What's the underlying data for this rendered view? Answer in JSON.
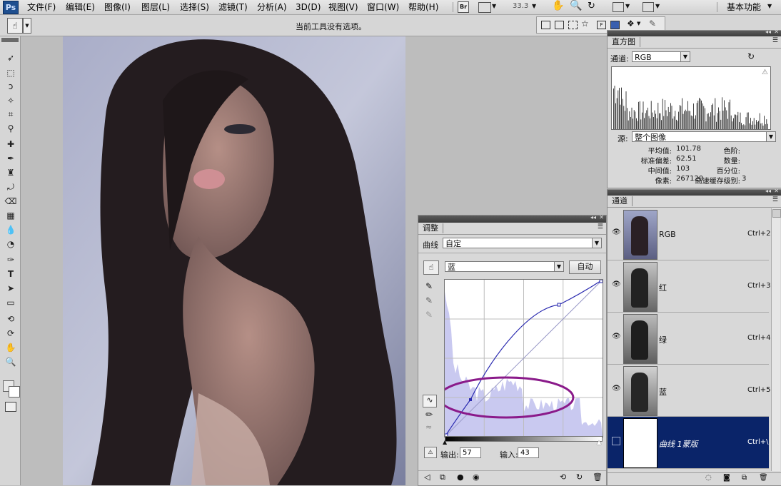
{
  "app": {
    "logo": "Ps"
  },
  "menu": [
    {
      "label": "文件(F)"
    },
    {
      "label": "编辑(E)"
    },
    {
      "label": "图像(I)"
    },
    {
      "label": "图层(L)"
    },
    {
      "label": "选择(S)"
    },
    {
      "label": "滤镜(T)"
    },
    {
      "label": "分析(A)"
    },
    {
      "label": "3D(D)"
    },
    {
      "label": "视图(V)"
    },
    {
      "label": "窗口(W)"
    },
    {
      "label": "帮助(H)"
    }
  ],
  "topbar": {
    "br_label": "Br",
    "zoom": "33.3",
    "workspace": "基本功能"
  },
  "options": {
    "message": "当前工具没有选项。"
  },
  "histogram": {
    "tab": "直方图",
    "channel_label": "通道:",
    "channel_value": "RGB",
    "source_label": "源:",
    "source_value": "整个图像",
    "stats": {
      "mean_label": "平均值:",
      "mean": "101.78",
      "std_label": "标准偏差:",
      "std": "62.51",
      "median_label": "中间值:",
      "median": "103",
      "pixels_label": "像素:",
      "pixels": "267120",
      "level_label": "色阶:",
      "level": "",
      "count_label": "数量:",
      "count": "",
      "percentile_label": "百分位:",
      "percentile": "",
      "cache_label": "高速缓存级别:",
      "cache": "3"
    }
  },
  "channels": {
    "tab": "通道",
    "rows": [
      {
        "name": "RGB",
        "shortcut": "Ctrl+2"
      },
      {
        "name": "红",
        "shortcut": "Ctrl+3"
      },
      {
        "name": "绿",
        "shortcut": "Ctrl+4"
      },
      {
        "name": "蓝",
        "shortcut": "Ctrl+5"
      },
      {
        "name": "曲线 1蒙版",
        "shortcut": "Ctrl+\\"
      }
    ]
  },
  "adjust": {
    "tab": "调整",
    "preset_label": "曲线",
    "preset_value": "自定",
    "channel_value": "蓝",
    "auto_label": "自动",
    "output_label": "输出:",
    "output_value": "57",
    "input_label": "输入:",
    "input_value": "43"
  },
  "colors": {
    "accent_mask": "#0a2469",
    "curve": "#2b2bb0",
    "ellipse": "#8a1a8a",
    "hist_fill": "#c9c9f0"
  }
}
